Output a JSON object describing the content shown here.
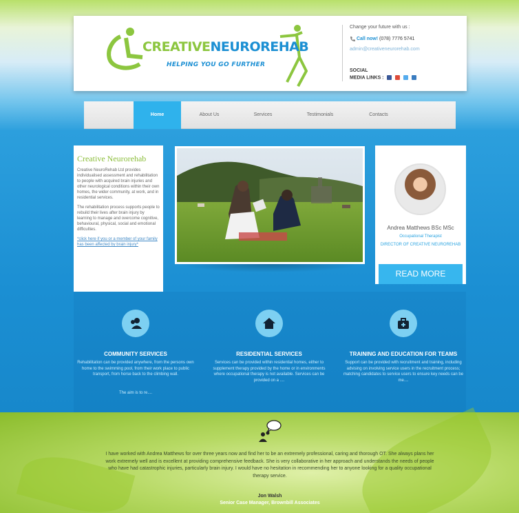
{
  "header": {
    "logo_text_green": "CREATIVE",
    "logo_text_blue": "NEUROREHAB",
    "logo_tagline": "HELPING YOU GO FURTHER",
    "contact_heading": "Change your future with us :",
    "call_label": "Call now!",
    "phone": "(078) 7776 5741",
    "email": "admin@creativeneurorehab.com",
    "social_label_1": "SOCIAL",
    "social_label_2": "MEDIA LINKS :",
    "social_icons": [
      "facebook-icon",
      "googleplus-icon",
      "twitter-icon",
      "linkedin-icon"
    ]
  },
  "nav": {
    "items": [
      {
        "label": "Home",
        "active": true
      },
      {
        "label": "About Us",
        "active": false
      },
      {
        "label": "Services",
        "active": false
      },
      {
        "label": "Testimonials",
        "active": false
      },
      {
        "label": "Contacts",
        "active": false
      }
    ]
  },
  "intro": {
    "title": "Creative Neurorehab",
    "para1": "Creative NeuroRehab Ltd provides individualised assessment and rehabilitation to people with acquired brain injuries and other neurological conditions within their own homes, the wider community, at work, and in residential services.",
    "para2": "The rehabilitation process supports people to rebuild their lives after brain injury by learning to manage and overcome cognitive, behavioural, physical, social and emotional difficulties.",
    "link": "*click here if you or a member of your family has been affected by brain injury*"
  },
  "profile": {
    "name": "Andrea Matthews BSc MSc",
    "role": "Occupational Therapist",
    "title": "DIRECTOR OF CREATIVE NEUROREHAB",
    "read_more": "READ MORE"
  },
  "services": [
    {
      "icon": "users-icon",
      "title": "COMMUNITY SERVICES",
      "body": "Rehabilitation can be provided anywhere, from the persons own home to the swimming pool, from their work place to public transport, from horse back to the climbing wall.",
      "more": "The aim is to re...."
    },
    {
      "icon": "home-icon",
      "title": "RESIDENTIAL SERVICES",
      "body": "Services can be provided within residential homes, either to supplement therapy provided by the home or in environments where occupational therapy is not available. Services can be provided on a ....",
      "more": ""
    },
    {
      "icon": "medkit-icon",
      "title": "TRAINING AND EDUCATION FOR TEAMS",
      "body": "Support can be provided with recruitment and training, including advising on involving service users in the recruitment process; matching candidates to service users to ensure key needs can be me....",
      "more": ""
    }
  ],
  "testimonial": {
    "icon": "speech-bubble-icon",
    "quote": "I have worked with Andrea Matthews for over three years now and find her to be an extremely professional, caring and thorough OT. She always plans her work extremely well and is excellent at providing comprehensive feedback. She is very collaborative in her approach and understands the needs of people who have had catastrophic injuries, particularly brain injury. I would have no hesitation in recommending her to anyone looking for a quality occupational therapy service.",
    "name": "Jon Walsh",
    "role": "Senior Case Manager, Brownbill Associates"
  },
  "colors": {
    "brand_green": "#8cc63f",
    "brand_blue": "#1b8fd3",
    "nav_active": "#2fb2ec",
    "read_more_bg": "#37b6ee"
  }
}
